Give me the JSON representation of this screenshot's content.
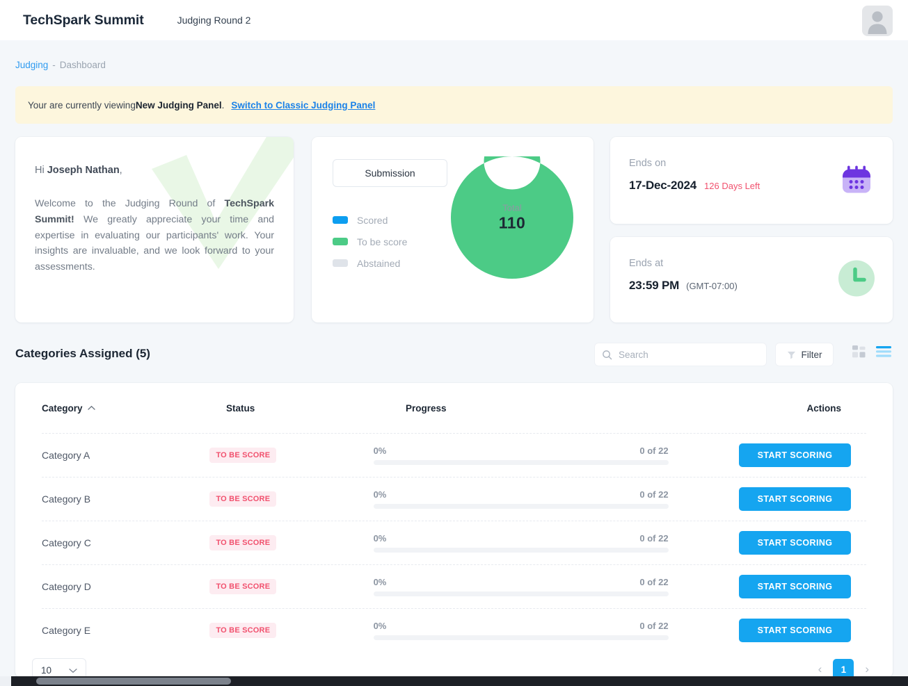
{
  "header": {
    "brand": "TechSpark Summit",
    "round": "Judging Round 2",
    "avatar_icon": "user-avatar-placeholder-icon"
  },
  "breadcrumb": {
    "link": "Judging",
    "separator": "-",
    "current": "Dashboard"
  },
  "banner": {
    "text_before": "Your are currently viewing ",
    "bold": "New Judging Panel",
    "text_after": ".",
    "link": "Switch to Classic Judging Panel"
  },
  "welcome": {
    "greeting_prefix": "Hi ",
    "name": "Joseph Nathan",
    "greeting_suffix": ",",
    "body_1": "Welcome to the Judging Round of ",
    "body_bold": "TechSpark Summit!",
    "body_2": " We greatly appreciate your time and expertise in evaluating our participants' work. Your insights are invaluable, and we look forward to your assessments.",
    "watermark_icon": "check-mark-watermark-icon"
  },
  "chart_card": {
    "submission_button": "Submission",
    "legend": [
      {
        "label": "Scored",
        "color": "#0d9ef0"
      },
      {
        "label": "To be score",
        "color": "#4ccb86"
      },
      {
        "label": "Abstained",
        "color": "#dfe3e9"
      }
    ],
    "center_label": "Total",
    "center_value": "110"
  },
  "chart_data": {
    "type": "pie",
    "title": "Submission",
    "categories": [
      "Scored",
      "To be score",
      "Abstained"
    ],
    "values": [
      0,
      110,
      0
    ],
    "colors": [
      "#0d9ef0",
      "#4ccb86",
      "#dfe3e9"
    ],
    "total": 110,
    "center_label": "Total",
    "center_value": "110",
    "legend_position": "left",
    "donut": true,
    "inner_radius_ratio": 0.46
  },
  "ends_on": {
    "label": "Ends on",
    "date": "17-Dec-2024",
    "days_left": "126 Days Left",
    "icon": "calendar-icon"
  },
  "ends_at": {
    "label": "Ends at",
    "time": "23:59 PM",
    "timezone": "(GMT-07:00)",
    "icon": "clock-icon"
  },
  "toolbar": {
    "section_title": "Categories Assigned (5)",
    "search_placeholder": "Search",
    "search_value": "",
    "search_icon": "search-icon",
    "filter_label": "Filter",
    "filter_icon": "funnel-icon",
    "grid_view_icon": "grid-view-icon",
    "list_view_icon": "list-view-icon"
  },
  "table": {
    "columns": [
      "Category",
      "Status",
      "Progress",
      "Actions"
    ],
    "sort_icon": "chevron-up-icon",
    "rows": [
      {
        "category": "Category A",
        "status": "TO BE SCORE",
        "percent": "0%",
        "progress": 0,
        "count": "0 of 22",
        "action": "START SCORING"
      },
      {
        "category": "Category B",
        "status": "TO BE SCORE",
        "percent": "0%",
        "progress": 0,
        "count": "0 of 22",
        "action": "START SCORING"
      },
      {
        "category": "Category C",
        "status": "TO BE SCORE",
        "percent": "0%",
        "progress": 0,
        "count": "0 of 22",
        "action": "START SCORING"
      },
      {
        "category": "Category D",
        "status": "TO BE SCORE",
        "percent": "0%",
        "progress": 0,
        "count": "0 of 22",
        "action": "START SCORING"
      },
      {
        "category": "Category E",
        "status": "TO BE SCORE",
        "percent": "0%",
        "progress": 0,
        "count": "0 of 22",
        "action": "START SCORING"
      }
    ]
  },
  "pagination": {
    "page_size": "10",
    "page_size_icon": "chevron-down-icon",
    "prev_icon": "chevron-left-icon",
    "next_icon": "chevron-right-icon",
    "current_page": "1"
  },
  "colors": {
    "accent_blue": "#15a5f0",
    "green": "#4ccb86",
    "danger_pink": "#f1516e",
    "banner_bg": "#fdf6dd",
    "purple": "#6d35e0"
  }
}
